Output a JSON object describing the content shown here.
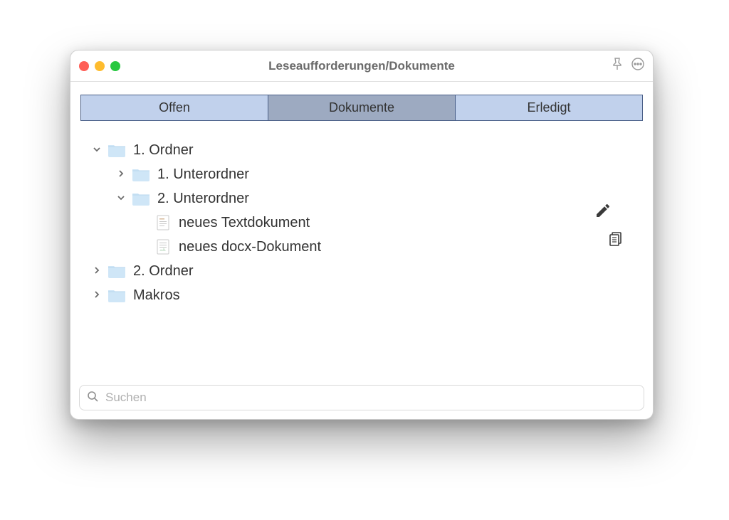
{
  "window": {
    "title": "Leseaufforderungen/Dokumente"
  },
  "tabs": {
    "open": "Offen",
    "docs": "Dokumente",
    "done": "Erledigt",
    "active": "docs"
  },
  "tree": {
    "folder1": "1. Ordner",
    "sub1": "1. Unterordner",
    "sub2": "2. Unterordner",
    "doc1": "neues Textdokument",
    "doc2": "neues docx-Dokument",
    "folder2": "2. Ordner",
    "macros": "Makros"
  },
  "search": {
    "placeholder": "Suchen"
  }
}
